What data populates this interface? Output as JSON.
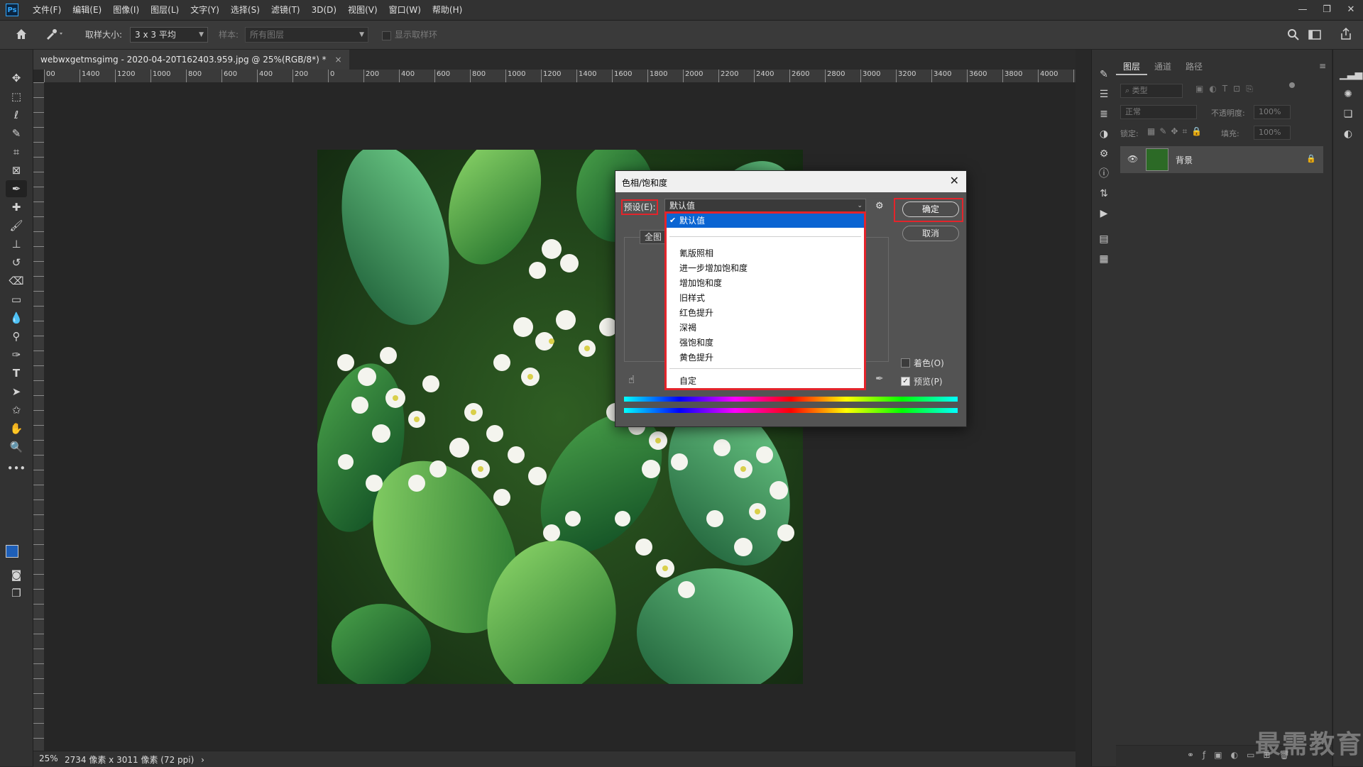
{
  "app": {
    "logo": "Ps"
  },
  "menu": [
    "文件(F)",
    "编辑(E)",
    "图像(I)",
    "图层(L)",
    "文字(Y)",
    "选择(S)",
    "滤镜(T)",
    "3D(D)",
    "视图(V)",
    "窗口(W)",
    "帮助(H)"
  ],
  "window_controls": {
    "minimize": "—",
    "restore": "❐",
    "close": "✕"
  },
  "options_bar": {
    "sample_size_label": "取样大小:",
    "sample_size_value": "3 x 3 平均",
    "sample_label": "样本:",
    "sample_value": "所有图层",
    "show_ring_label": "显示取样环"
  },
  "document": {
    "tab_title": "webwxgetmsgimg - 2020-04-20T162403.959.jpg @ 25%(RGB/8*) *",
    "tab_close": "×"
  },
  "ruler": {
    "h_labels": [
      "00",
      "1400",
      "1200",
      "1000",
      "800",
      "600",
      "400",
      "200",
      "0",
      "200",
      "400",
      "600",
      "800",
      "1000",
      "1200",
      "1400",
      "1600",
      "1800",
      "2000",
      "2200",
      "2400",
      "2600",
      "2800",
      "3000",
      "3200",
      "3400",
      "3600",
      "3800",
      "4000",
      "42"
    ]
  },
  "status": {
    "zoom": "25%",
    "info": "2734 像素 x 3011 像素 (72 ppi)",
    "arrow": "›"
  },
  "layers_panel": {
    "tabs": [
      "图层",
      "通道",
      "路径"
    ],
    "active_tab": "图层",
    "kind_filter": "类型",
    "blend_mode": "正常",
    "opacity_label": "不透明度:",
    "opacity_value": "100%",
    "lock_label": "锁定:",
    "fill_label": "填充:",
    "fill_value": "100%",
    "layer_name": "背景"
  },
  "watermark": "最需教育",
  "dialog": {
    "title": "色相/饱和度",
    "close": "✕",
    "preset_label": "预设(E):",
    "preset_value": "默认值",
    "ok": "确定",
    "cancel": "取消",
    "channel": "全图",
    "colorize": "着色(O)",
    "preview": "预览(P)",
    "preview_checked": true,
    "colorize_checked": false
  },
  "dropdown": {
    "selected": "默认值",
    "items": [
      "氰版照相",
      "进一步增加饱和度",
      "增加饱和度",
      "旧样式",
      "红色提升",
      "深褐",
      "强饱和度",
      "黄色提升"
    ],
    "custom": "自定"
  },
  "colors": {
    "highlight_red": "#e3242b",
    "selection_blue": "#0a64d2",
    "ps_blue": "#31a8ff"
  }
}
